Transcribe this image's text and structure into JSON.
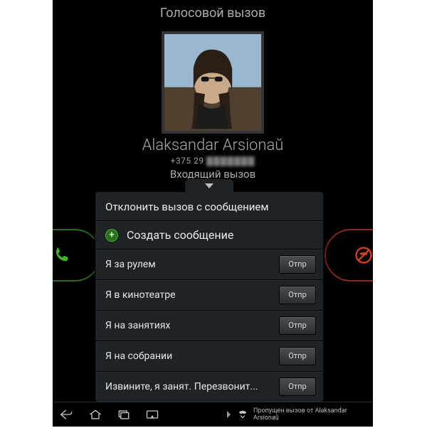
{
  "header": {
    "title": "Голосовой вызов"
  },
  "caller": {
    "name": "Alaksandar Arsionaŭ",
    "phone_prefix": "+375 29",
    "phone_masked": "▓▓▓▓▓▓▓",
    "status": "Входящий вызов"
  },
  "actions": {
    "answer_icon": "phone-icon",
    "reject_icon": "phone-slash-icon"
  },
  "reject_panel": {
    "title": "Отклонить вызов с сообщением",
    "compose_label": "Создать сообщение",
    "send_label": "Отпр",
    "messages": [
      "Я за рулем",
      "Я в кинотеатре",
      "Я на занятиях",
      "Я на собрании",
      "Извините, я занят. Перезвонит..."
    ]
  },
  "navbar": {
    "notification_text": "Пропущен вызов от Alaksandar Arsionaŭ"
  },
  "colors": {
    "background": "#000000",
    "panel": "#1f2326",
    "accent_answer": "#2f6a1f",
    "accent_reject": "#8c2a12",
    "text_primary": "#e9ebec",
    "text_secondary": "#a8abad"
  }
}
